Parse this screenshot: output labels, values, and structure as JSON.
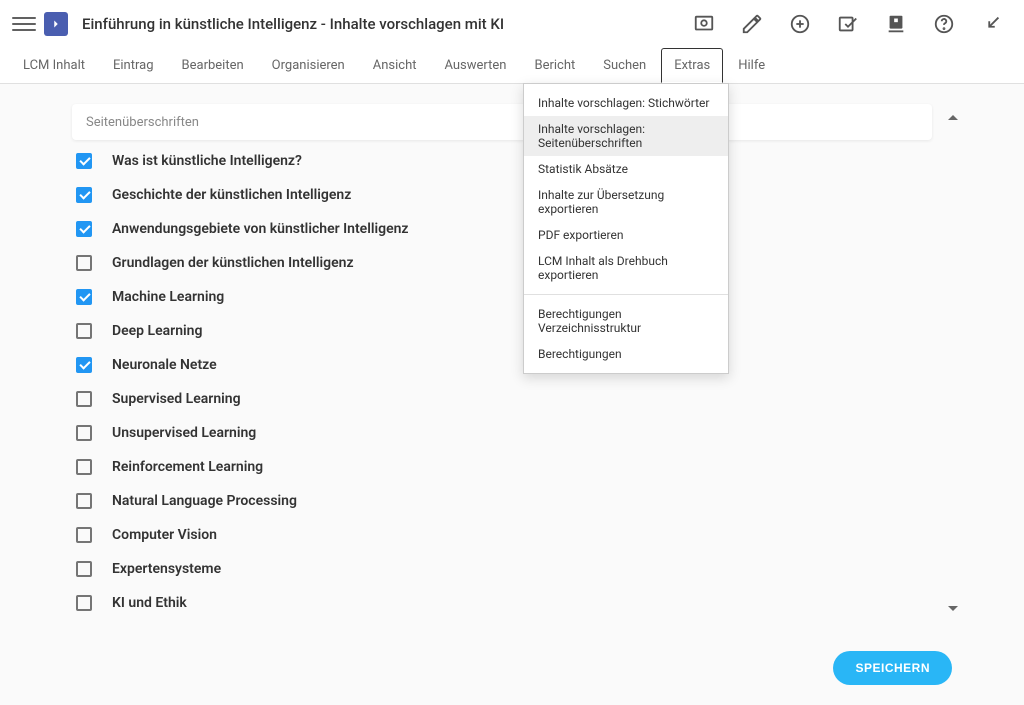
{
  "header": {
    "title": "Einführung in künstliche Intelligenz - Inhalte vorschlagen mit KI"
  },
  "menu": {
    "items": [
      "LCM Inhalt",
      "Eintrag",
      "Bearbeiten",
      "Organisieren",
      "Ansicht",
      "Auswerten",
      "Bericht",
      "Suchen",
      "Extras",
      "Hilfe"
    ],
    "activeIndex": 8
  },
  "dropdown": {
    "group1": [
      "Inhalte vorschlagen: Stichwörter",
      "Inhalte vorschlagen: Seitenüberschriften",
      "Statistik Absätze",
      "Inhalte zur Übersetzung exportieren",
      "PDF exportieren",
      "LCM Inhalt als Drehbuch exportieren"
    ],
    "group2": [
      "Berechtigungen Verzeichnisstruktur",
      "Berechtigungen"
    ],
    "highlightedIndex": 1
  },
  "search": {
    "placeholder": "Seitenüberschriften"
  },
  "headings": [
    {
      "label": "Was ist künstliche Intelligenz?",
      "checked": true
    },
    {
      "label": "Geschichte der künstlichen Intelligenz",
      "checked": true
    },
    {
      "label": "Anwendungsgebiete von künstlicher Intelligenz",
      "checked": true
    },
    {
      "label": "Grundlagen der künstlichen Intelligenz",
      "checked": false
    },
    {
      "label": "Machine Learning",
      "checked": true
    },
    {
      "label": "Deep Learning",
      "checked": false
    },
    {
      "label": "Neuronale Netze",
      "checked": true
    },
    {
      "label": "Supervised Learning",
      "checked": false
    },
    {
      "label": "Unsupervised Learning",
      "checked": false
    },
    {
      "label": "Reinforcement Learning",
      "checked": false
    },
    {
      "label": "Natural Language Processing",
      "checked": false
    },
    {
      "label": "Computer Vision",
      "checked": false
    },
    {
      "label": "Expertensysteme",
      "checked": false
    },
    {
      "label": "KI und Ethik",
      "checked": false
    }
  ],
  "footer": {
    "save_label": "SPEICHERN"
  }
}
